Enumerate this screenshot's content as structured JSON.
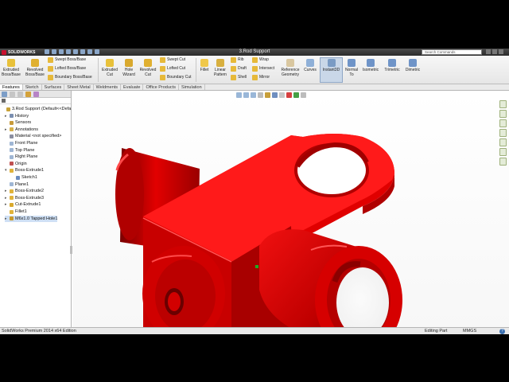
{
  "app": {
    "logo_text": "SOLIDWORKS",
    "document_title": "3.Rod Support",
    "search_placeholder": "Search Commands"
  },
  "toolbar": {
    "extruded_boss": "Extruded Boss/Base",
    "revolved_boss": "Revolved Boss/Base",
    "swept_boss": "Swept Boss/Base",
    "lofted_boss": "Lofted Boss/Base",
    "boundary_boss": "Boundary Boss/Base",
    "extruded_cut": "Extruded Cut",
    "hole_wizard": "Hole Wizard",
    "revolved_cut": "Revolved Cut",
    "swept_cut": "Swept Cut",
    "lofted_cut": "Lofted Cut",
    "boundary_cut": "Boundary Cut",
    "fillet": "Fillet",
    "linear_pattern": "Linear Pattern",
    "rib": "Rib",
    "draft": "Draft",
    "shell": "Shell",
    "wrap": "Wrap",
    "intersect": "Intersect",
    "mirror": "Mirror",
    "reference_geometry": "Reference Geometry",
    "curves": "Curves",
    "instant3d": "Instant3D",
    "normal_to": "Normal To",
    "isometric": "Isometric",
    "trimetric": "Trimetric",
    "dimetric": "Dimetric"
  },
  "tabs": [
    "Features",
    "Sketch",
    "Surfaces",
    "Sheet Metal",
    "Weldments",
    "Evaluate",
    "Office Products",
    "Simulation"
  ],
  "feature_tree": [
    {
      "label": "3.Rod Support  (Default<<Defa",
      "icon": "part-icon",
      "expand": ""
    },
    {
      "label": "History",
      "icon": "history-icon",
      "expand": "▸"
    },
    {
      "label": "Sensors",
      "icon": "sensors-icon",
      "expand": ""
    },
    {
      "label": "Annotations",
      "icon": "annotations-icon",
      "expand": "▸"
    },
    {
      "label": "Material <not specified>",
      "icon": "material-icon",
      "expand": ""
    },
    {
      "label": "Front Plane",
      "icon": "plane-icon",
      "expand": ""
    },
    {
      "label": "Top Plane",
      "icon": "plane-icon",
      "expand": ""
    },
    {
      "label": "Right Plane",
      "icon": "plane-icon",
      "expand": ""
    },
    {
      "label": "Origin",
      "icon": "origin-icon",
      "expand": ""
    },
    {
      "label": "Boss-Extrude1",
      "icon": "boss-extrude-icon",
      "expand": "▾"
    },
    {
      "label": "Sketch1",
      "icon": "sketch-icon",
      "expand": ""
    },
    {
      "label": "Plane1",
      "icon": "plane-icon",
      "expand": ""
    },
    {
      "label": "Boss-Extrude2",
      "icon": "boss-extrude-icon",
      "expand": "▸"
    },
    {
      "label": "Boss-Extrude3",
      "icon": "boss-extrude-icon",
      "expand": "▸"
    },
    {
      "label": "Cut-Extrude1",
      "icon": "cut-extrude-icon",
      "expand": "▸"
    },
    {
      "label": "Fillet1",
      "icon": "fillet-icon",
      "expand": ""
    },
    {
      "label": "M6x1.0 Tapped Hole1",
      "icon": "hole-icon",
      "expand": "▸"
    }
  ],
  "status": {
    "version": "SolidWorks Premium 2014 x64 Edition",
    "mode": "Editing Part",
    "units": "MMGS",
    "help": "?"
  },
  "colors": {
    "model_red": "#d40000",
    "accent_blue": "#3a6fb0",
    "command_bar": "#ececec"
  }
}
